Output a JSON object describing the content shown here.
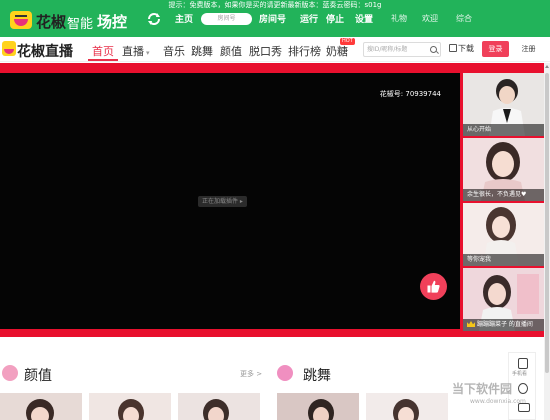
{
  "tool_bar": {
    "notice": "提示：免费版本，如果你是买的请更新最新版本：蓝奏云密码：s01g",
    "brand": "花椒",
    "brand_zhineng": "智能",
    "brand_changkong": "场控",
    "nav_home": "主页",
    "room_input_placeholder": "房间号",
    "nav_room": "房间号",
    "nav_run": "运行",
    "nav_stop": "停止",
    "nav_settings": "设置",
    "nav_gift": "礼物",
    "nav_welcome": "欢迎",
    "nav_general": "综合",
    "background_color": "#22b35a"
  },
  "site_header": {
    "brand": "花椒直播",
    "nav": [
      "首页",
      "直播",
      "音乐",
      "跳舞",
      "颜值",
      "脱口秀",
      "排行榜",
      "奶糖"
    ],
    "live_dropdown_arrow": "▾",
    "hot_badge": "HOT",
    "search_placeholder": "搜ID/昵称/标题",
    "download_label": "下载",
    "login_label": "登录",
    "register_label": "注册",
    "accent_color": "#e8304a"
  },
  "player": {
    "room_number_text": "花椒号: 70939744",
    "loading_tip": "正在加载插件 ▸",
    "band_color": "#e8102e"
  },
  "side_list": [
    {
      "caption": "从心开始"
    },
    {
      "caption": "余生很长，不负遇见♥"
    },
    {
      "caption": "等你宠我"
    },
    {
      "caption": "蹦蹦蹦菜子 的直播间"
    }
  ],
  "bottom": {
    "category_yanzhi": "颜值",
    "more_yanzhi": "更多 >",
    "category_tiaowu": "跳舞",
    "more_tiaowu": "更多 >",
    "float_label": "手机看"
  },
  "watermark": {
    "text": "当下软件园",
    "sub": "www.downxia.com"
  }
}
